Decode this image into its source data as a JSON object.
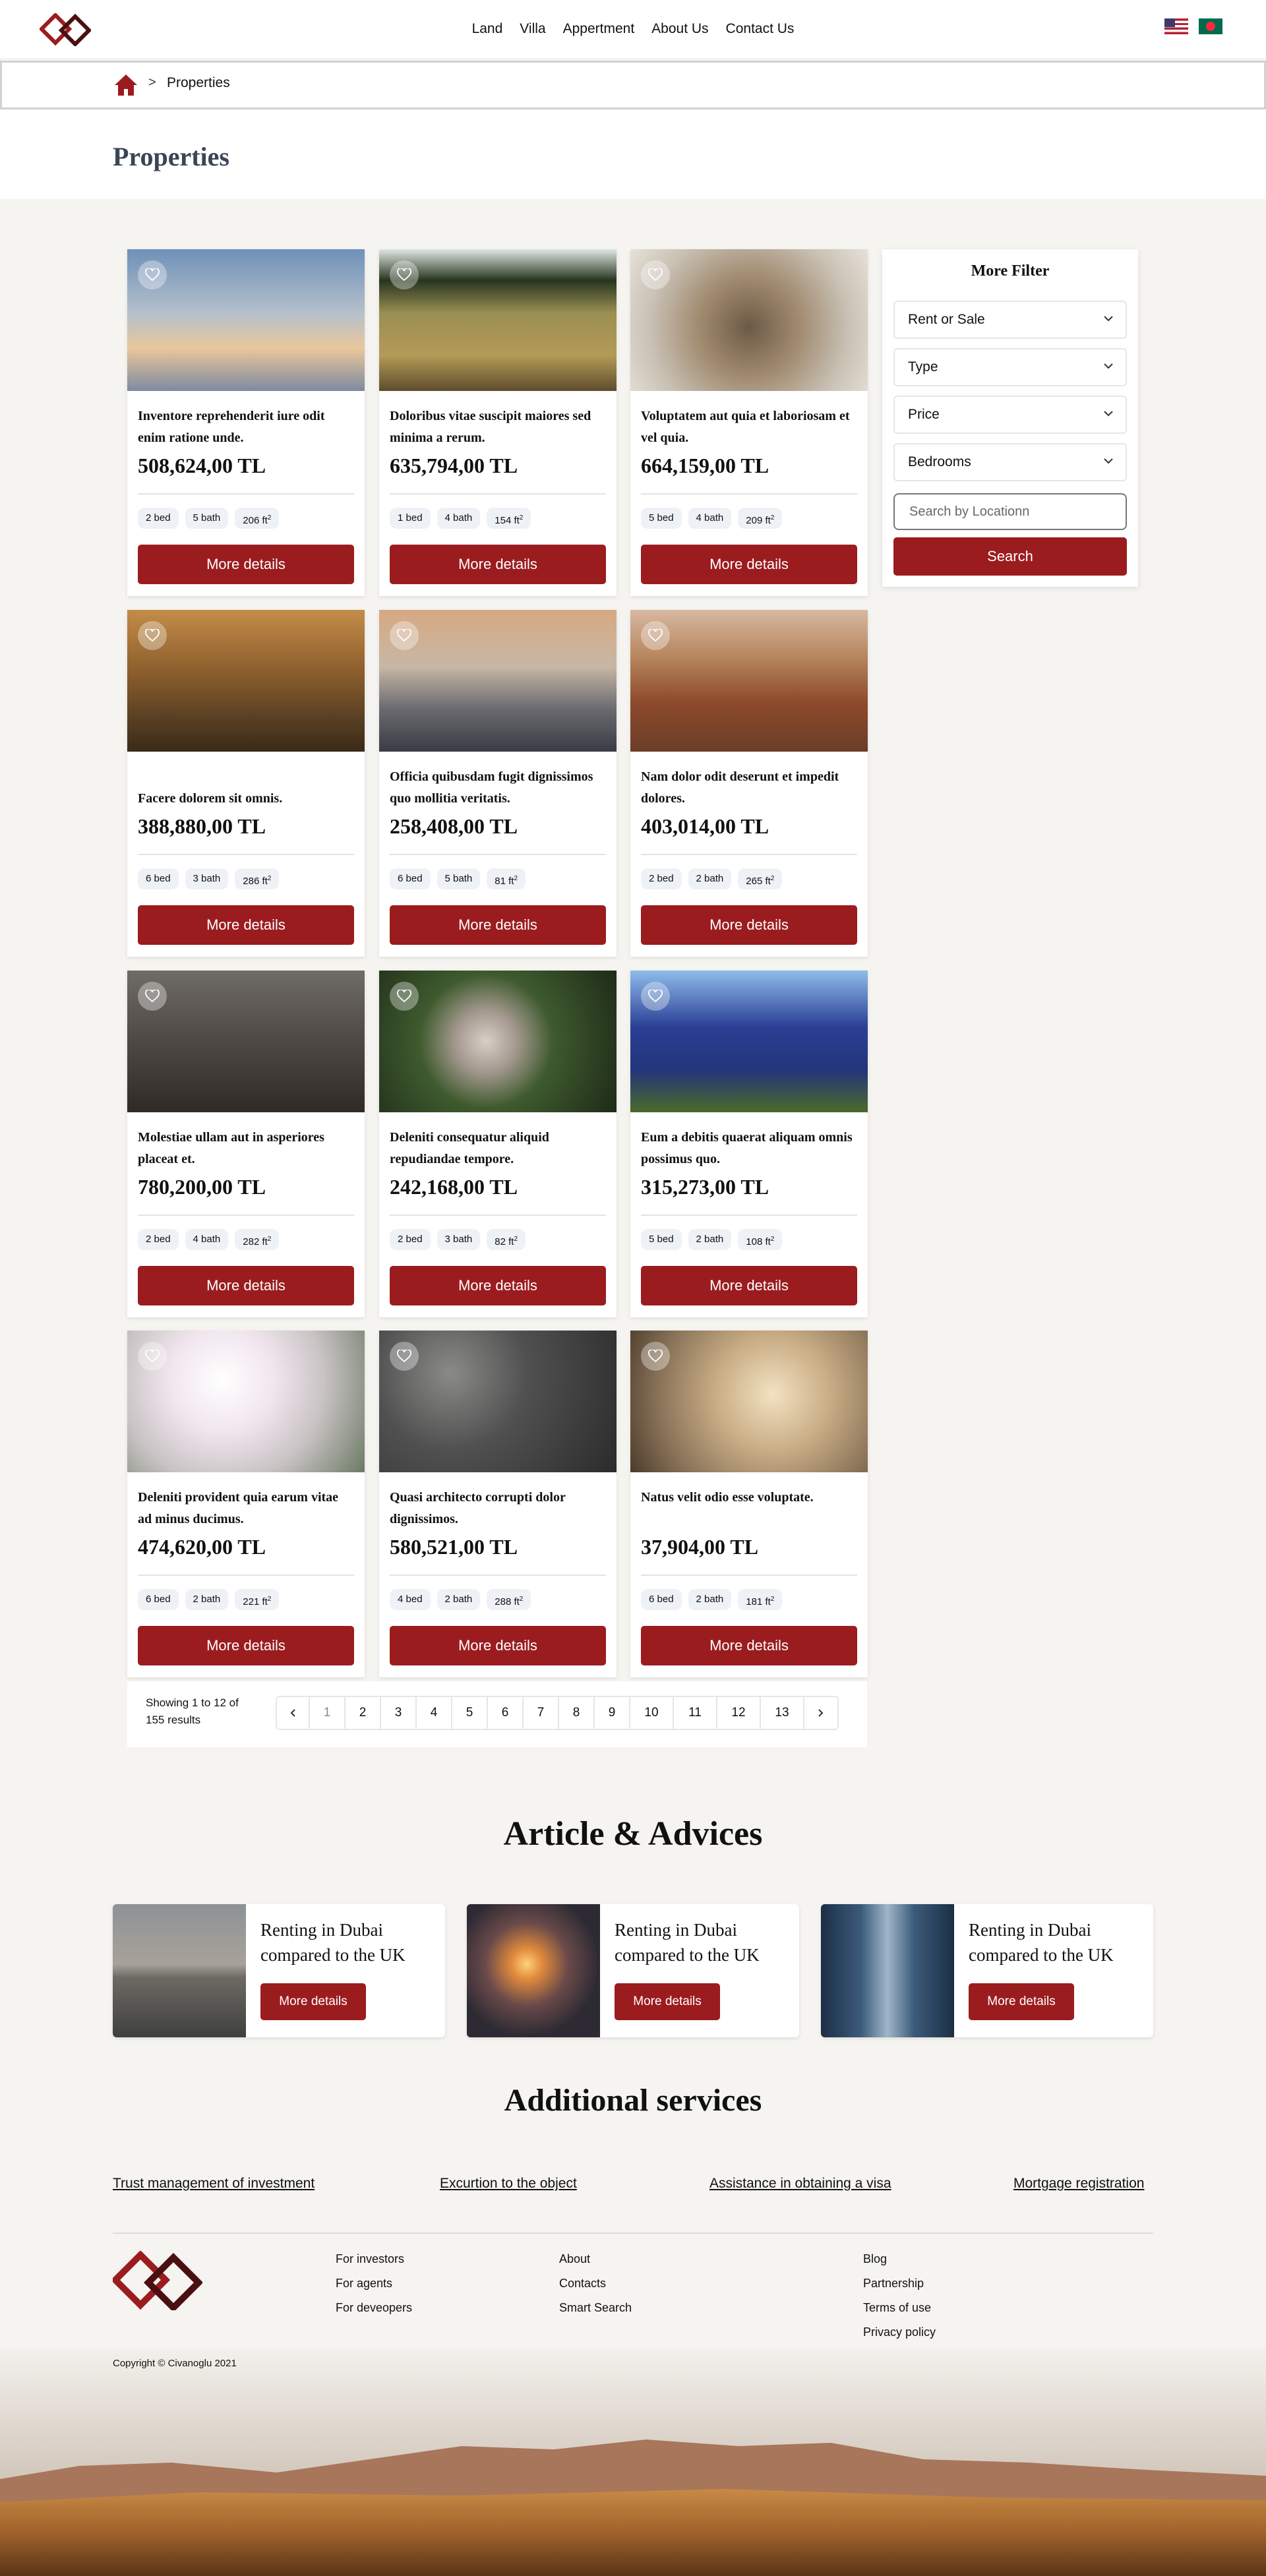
{
  "nav": {
    "items": [
      "Land",
      "Villa",
      "Appertment",
      "About Us",
      "Contact Us"
    ]
  },
  "breadcrumb": {
    "separator": ">",
    "current": "Properties"
  },
  "page": {
    "title": "Properties"
  },
  "properties": [
    {
      "title": "Inventore reprehenderit iure odit enim ratione unde.",
      "price": "508,624,00 TL",
      "bed": "2 bed",
      "bath": "5 bath",
      "area": "206 ft"
    },
    {
      "title": "Doloribus vitae suscipit maiores sed minima a rerum.",
      "price": "635,794,00 TL",
      "bed": "1 bed",
      "bath": "4 bath",
      "area": "154 ft"
    },
    {
      "title": "Voluptatem aut quia et laboriosam et vel quia.",
      "price": "664,159,00 TL",
      "bed": "5 bed",
      "bath": "4 bath",
      "area": "209 ft"
    },
    {
      "title": "Facere dolorem sit omnis.",
      "price": "388,880,00 TL",
      "bed": "6 bed",
      "bath": "3 bath",
      "area": "286 ft"
    },
    {
      "title": "Officia quibusdam fugit dignissimos quo mollitia veritatis.",
      "price": "258,408,00 TL",
      "bed": "6 bed",
      "bath": "5 bath",
      "area": "81 ft"
    },
    {
      "title": "Nam dolor odit deserunt et impedit dolores.",
      "price": "403,014,00 TL",
      "bed": "2 bed",
      "bath": "2 bath",
      "area": "265 ft"
    },
    {
      "title": "Molestiae ullam aut in asperiores placeat et.",
      "price": "780,200,00 TL",
      "bed": "2 bed",
      "bath": "4 bath",
      "area": "282 ft"
    },
    {
      "title": "Deleniti consequatur aliquid repudiandae tempore.",
      "price": "242,168,00 TL",
      "bed": "2 bed",
      "bath": "3 bath",
      "area": "82 ft"
    },
    {
      "title": "Eum a debitis quaerat aliquam omnis possimus quo.",
      "price": "315,273,00 TL",
      "bed": "5 bed",
      "bath": "2 bath",
      "area": "108 ft"
    },
    {
      "title": "Deleniti provident quia earum vitae ad minus ducimus.",
      "price": "474,620,00 TL",
      "bed": "6 bed",
      "bath": "2 bath",
      "area": "221 ft"
    },
    {
      "title": "Quasi architecto corrupti dolor dignissimos.",
      "price": "580,521,00 TL",
      "bed": "4 bed",
      "bath": "2 bath",
      "area": "288 ft"
    },
    {
      "title": "Natus velit odio esse voluptate.",
      "price": "37,904,00 TL",
      "bed": "6 bed",
      "bath": "2 bath",
      "area": "181 ft"
    }
  ],
  "area_unit_sup": "2",
  "more_details_label": "More details",
  "filter": {
    "title": "More Filter",
    "rent_or_sale": "Rent or Sale",
    "type": "Type",
    "price": "Price",
    "bedrooms": "Bedrooms",
    "location_placeholder": "Search by Locationn",
    "search_label": "Search"
  },
  "pagination": {
    "info": "Showing 1 to 12 of 155 results",
    "prev_icon": "chevron-left-icon",
    "next_icon": "chevron-right-icon",
    "pages": [
      "1",
      "2",
      "3",
      "4",
      "5",
      "6",
      "7",
      "8",
      "9",
      "10",
      "11",
      "12",
      "13"
    ],
    "current": "1"
  },
  "articles": {
    "title": "Article & Advices",
    "items": [
      {
        "title": "Renting in Dubai compared to the UK",
        "button": "More details"
      },
      {
        "title": "Renting in Dubai compared to the UK",
        "button": "More details"
      },
      {
        "title": "Renting in Dubai compared to the UK",
        "button": "More details"
      }
    ]
  },
  "services": {
    "title": "Additional services",
    "items": [
      "Trust management of investment",
      "Excurtion to the object",
      "Assistance in obtaining a visa",
      "Mortgage registration"
    ]
  },
  "footer": {
    "col1": [
      "For investors",
      "For agents",
      "For deveopers"
    ],
    "col2": [
      "About",
      "Contacts",
      "Smart Search"
    ],
    "col3": [
      "Blog",
      "Partnership",
      "Terms of use",
      "Privacy policy"
    ],
    "copyright": "Copyright © Civanoglu 2021"
  },
  "colors": {
    "accent": "#9b1c1f",
    "title": "#3a4656",
    "background": "#f5f4f0"
  }
}
